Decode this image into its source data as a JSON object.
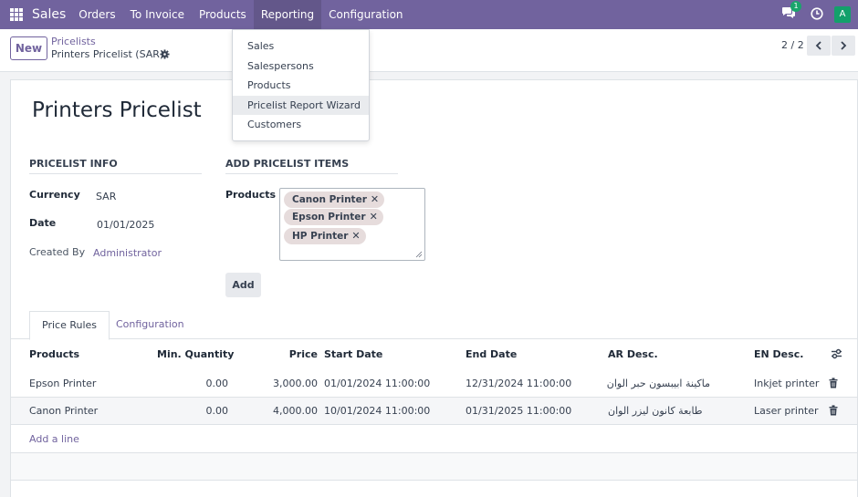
{
  "navbar": {
    "app_name": "Sales",
    "menu": [
      "Orders",
      "To Invoice",
      "Products",
      "Reporting",
      "Configuration"
    ],
    "chat_badge": "1",
    "avatar_letter": "A",
    "color": "#71639e"
  },
  "control": {
    "new_label": "New",
    "breadcrumb_parent": "Pricelists",
    "breadcrumb_current": "Printers Pricelist (SAR)",
    "pager": "2 / 2"
  },
  "reporting_menu": {
    "items": [
      "Sales",
      "Salespersons",
      "Products",
      "Pricelist Report Wizard",
      "Customers"
    ],
    "highlighted": "Pricelist Report Wizard"
  },
  "form": {
    "title": "Printers Pricelist",
    "section_info": "PRICELIST INFO",
    "section_add": "ADD PRICELIST ITEMS",
    "currency_label": "Currency",
    "currency_value": "SAR",
    "date_label": "Date",
    "date_value": "01/01/2025",
    "created_by_label": "Created By",
    "created_by_value": "Administrator",
    "products_label": "Products",
    "product_tags": [
      "Canon Printer",
      "Epson Printer",
      "HP Printer"
    ],
    "add_button": "Add"
  },
  "tabs": [
    "Price Rules",
    "Configuration"
  ],
  "table": {
    "headers": [
      "Products",
      "Min. Quantity",
      "Price",
      "Start Date",
      "End Date",
      "AR Desc.",
      "EN Desc."
    ],
    "rows": [
      [
        "Epson Printer",
        "0.00",
        "3,000.00",
        "01/01/2024 11:00:00",
        "12/31/2024 11:00:00",
        "ماكينة ابيبسون حبر الوان",
        "Inkjet printer"
      ],
      [
        "Canon Printer",
        "0.00",
        "4,000.00",
        "10/01/2024 11:00:00",
        "01/31/2025 11:00:00",
        "طابعة كانون ليزر الوان",
        "Laser printer"
      ]
    ],
    "add_line": "Add a line"
  }
}
